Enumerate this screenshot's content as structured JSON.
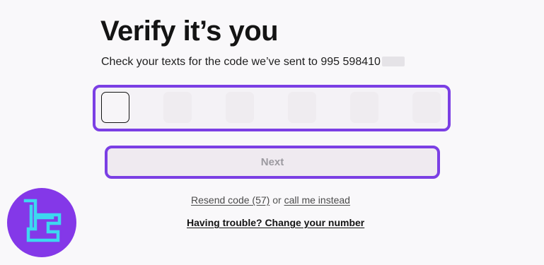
{
  "header": {
    "title": "Verify it’s you",
    "subtitle": "Check your texts for the code we’ve sent to 995 598410"
  },
  "code_input": {
    "digit_count": 6,
    "active_digit": 1
  },
  "actions": {
    "next_label": "Next",
    "resend_label": "Resend code (57)",
    "or_text": "or",
    "call_label": "call me instead",
    "trouble_label": "Having trouble? Change your number"
  },
  "colors": {
    "accent": "#7b3fe4",
    "logo_bg": "#8438e8",
    "logo_mark": "#3dd8f0"
  },
  "icons": {
    "logo": "tradingfinder-logo"
  }
}
